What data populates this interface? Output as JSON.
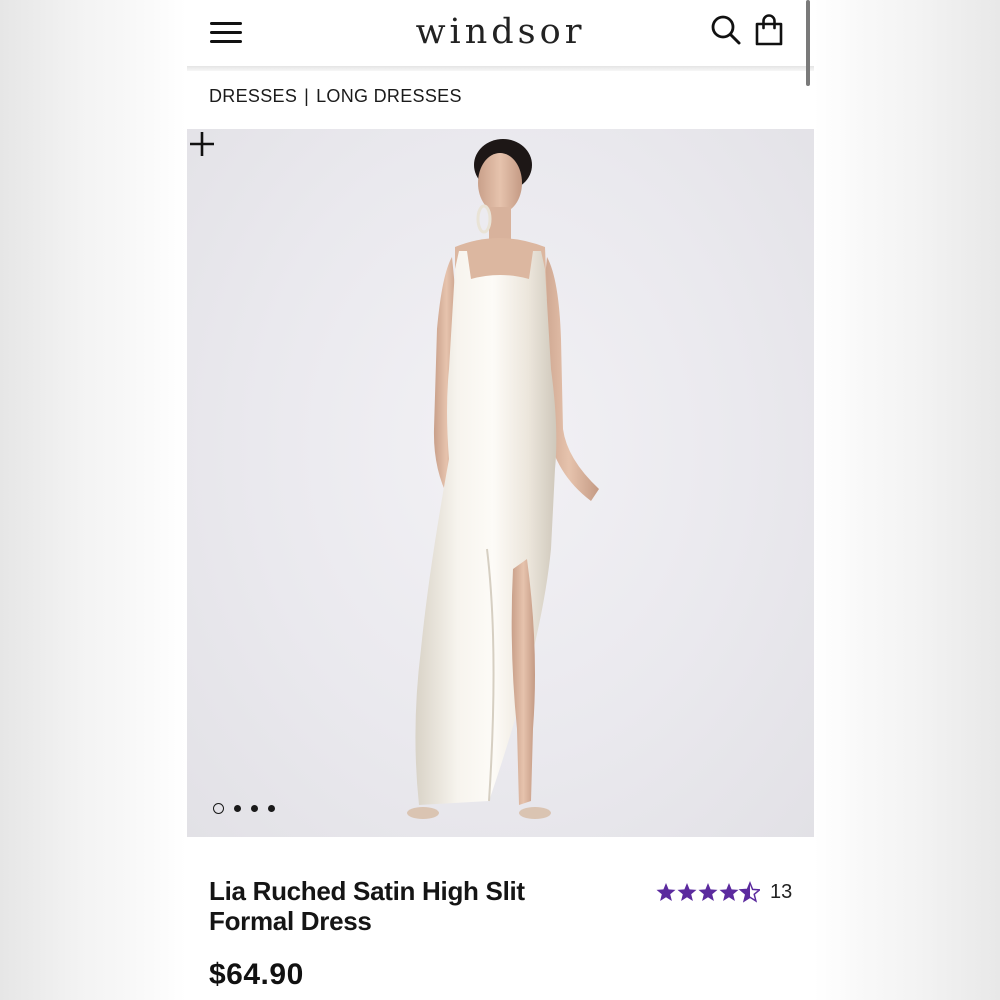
{
  "header": {
    "logo_text": "WINDSOR",
    "menu_icon": "hamburger-menu-icon",
    "search_icon": "search-icon",
    "bag_icon": "shopping-bag-icon"
  },
  "breadcrumb": {
    "items": [
      "DRESSES",
      "LONG DRESSES"
    ],
    "separator": "|"
  },
  "gallery": {
    "image_alt": "Model wearing ivory satin high slit formal gown",
    "total_images": 4,
    "active_index": 0,
    "zoom_icon": "plus-icon"
  },
  "product": {
    "title": "Lia Ruched Satin High Slit Formal Dress",
    "rating": 4.5,
    "rating_max": 5,
    "review_count": "13",
    "price": "$64.90",
    "star_color": "#5b2a9e"
  },
  "colors": {
    "text": "#151515",
    "accent": "#5b2a9e"
  }
}
